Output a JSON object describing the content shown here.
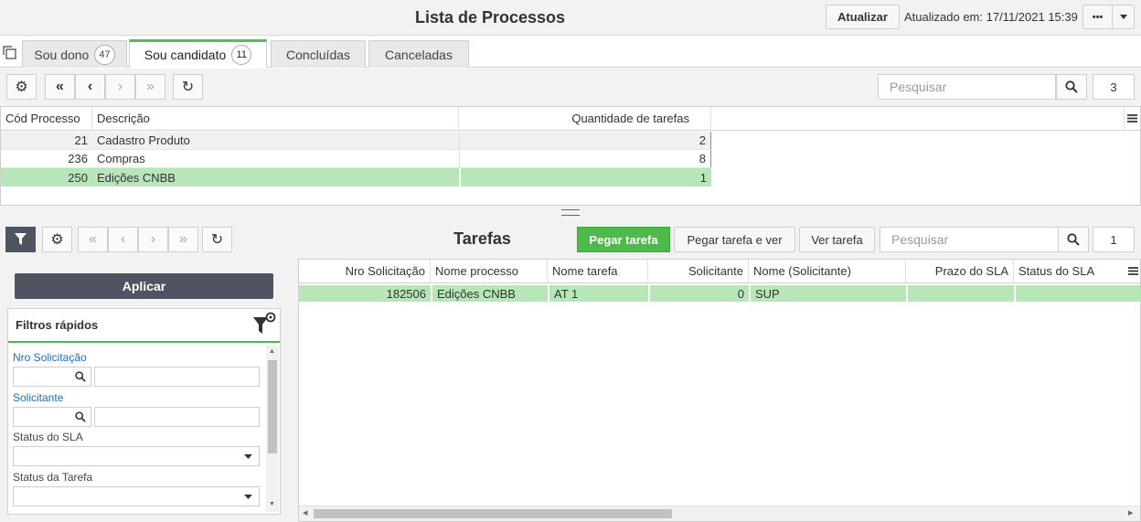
{
  "header": {
    "title": "Lista de Processos",
    "refresh_label": "Atualizar",
    "updated_text": "Atualizado em: 17/11/2021 15:39",
    "more_label": "•••"
  },
  "tabs": [
    {
      "label": "Sou dono",
      "count": "47"
    },
    {
      "label": "Sou candidato",
      "count": "11"
    },
    {
      "label": "Concluídas"
    },
    {
      "label": "Canceladas"
    }
  ],
  "processes": {
    "search_placeholder": "Pesquisar",
    "count": "3",
    "columns": [
      "Cód Processo",
      "Descrição",
      "Quantidade de tarefas"
    ],
    "rows": [
      {
        "code": "21",
        "desc": "Cadastro Produto",
        "qty": "2"
      },
      {
        "code": "236",
        "desc": "Compras",
        "qty": "8"
      },
      {
        "code": "250",
        "desc": "Edições CNBB",
        "qty": "1"
      }
    ]
  },
  "tasks": {
    "title": "Tarefas",
    "take_label": "Pegar tarefa",
    "take_view_label": "Pegar tarefa e ver",
    "view_label": "Ver tarefa",
    "search_placeholder": "Pesquisar",
    "count": "1",
    "columns": [
      "Nro Solicitação",
      "Nome processo",
      "Nome tarefa",
      "Solicitante",
      "Nome (Solicitante)",
      "Prazo do SLA",
      "Status do SLA"
    ],
    "rows": [
      {
        "nro": "182506",
        "processo": "Edições CNBB",
        "tarefa": "AT 1",
        "solicitante": "0",
        "nome": "SUP",
        "prazo": "",
        "status": ""
      }
    ]
  },
  "filters": {
    "apply_label": "Aplicar",
    "quick_title": "Filtros rápidos",
    "nro_label": "Nro Solicitação",
    "solicitante_label": "Solicitante",
    "status_sla_label": "Status do SLA",
    "status_tarefa_label": "Status da Tarefa"
  },
  "colors": {
    "accent_green": "#4cbb4a",
    "selected_row": "#b7e6b8",
    "label_blue": "#1a6fc4"
  }
}
